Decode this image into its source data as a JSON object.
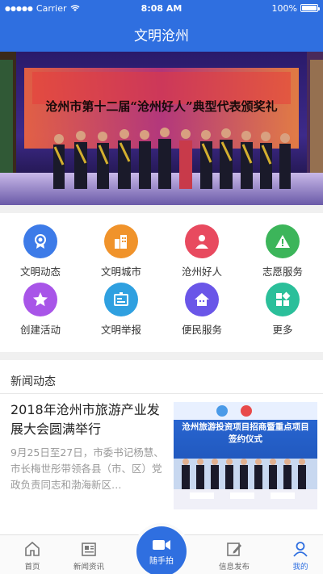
{
  "status_bar": {
    "carrier": "Carrier",
    "time": "8:08 AM",
    "battery": "100%"
  },
  "nav": {
    "title": "文明沧州"
  },
  "banner": {
    "stage_text": "沧州市第十二届“沧州好人”典型代表颁奖礼"
  },
  "grid": [
    {
      "label": "文明动态",
      "icon": "gear-badge-icon",
      "color": "#3d7be8"
    },
    {
      "label": "文明城市",
      "icon": "buildings-icon",
      "color": "#f0932b"
    },
    {
      "label": "沧州好人",
      "icon": "person-icon",
      "color": "#e84a5f"
    },
    {
      "label": "志愿服务",
      "icon": "warning-triangle-icon",
      "color": "#3cb55a"
    },
    {
      "label": "创建活动",
      "icon": "star-icon",
      "color": "#a855e8"
    },
    {
      "label": "文明举报",
      "icon": "report-icon",
      "color": "#2fa0e0"
    },
    {
      "label": "便民服务",
      "icon": "house-icon",
      "color": "#6a56e8"
    },
    {
      "label": "更多",
      "icon": "more-grid-icon",
      "color": "#2bbf9a"
    }
  ],
  "news_section": {
    "title": "新闻动态",
    "items": [
      {
        "title": "2018年沧州市旅游产业发展大会圆满举行",
        "summary": "9月25日至27日，市委书记杨慧、市长梅世彤带领各县（市、区）党政负责同志和渤海新区…",
        "thumb_text": "沧州旅游投资项目招商暨重点项目签约仪式"
      }
    ]
  },
  "tab_bar": {
    "tabs": [
      {
        "label": "首页",
        "icon": "home-icon"
      },
      {
        "label": "新闻资讯",
        "icon": "newspaper-icon"
      },
      {
        "label": "随手拍",
        "icon": "camera-icon"
      },
      {
        "label": "信息发布",
        "icon": "edit-icon"
      },
      {
        "label": "我的",
        "icon": "user-icon"
      }
    ],
    "active_index": 4,
    "accent": "#2f6fe0"
  }
}
